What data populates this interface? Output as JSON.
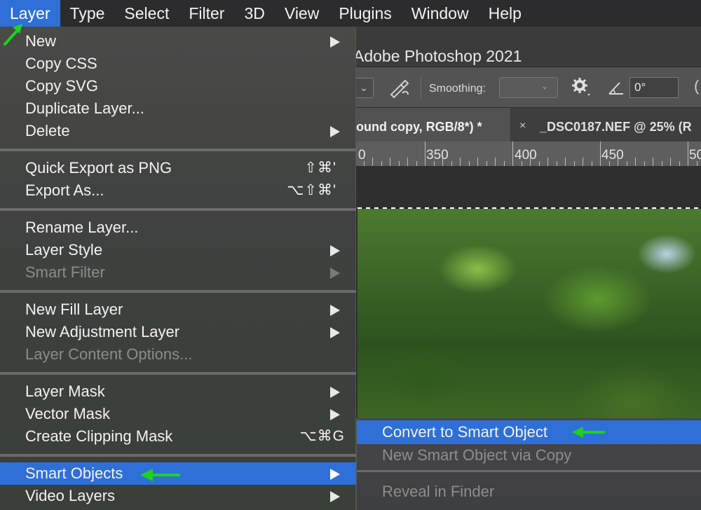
{
  "menubar": {
    "items": [
      {
        "label": "Layer",
        "active": true
      },
      {
        "label": "Type"
      },
      {
        "label": "Select"
      },
      {
        "label": "Filter"
      },
      {
        "label": "3D"
      },
      {
        "label": "View"
      },
      {
        "label": "Plugins"
      },
      {
        "label": "Window"
      },
      {
        "label": "Help"
      }
    ]
  },
  "app": {
    "title": "Adobe Photoshop 2021",
    "options": {
      "smoothing_label": "Smoothing:",
      "angle_value": "0°",
      "paren": "("
    },
    "tabs": [
      {
        "label": "ound copy, RGB/8*) *"
      },
      {
        "close": "×",
        "label": "_DSC0187.NEF @ 25% (R"
      }
    ],
    "ruler": [
      "0",
      "350",
      "400",
      "450",
      "50"
    ]
  },
  "layer_menu": {
    "items": [
      {
        "label": "New",
        "submenu": true
      },
      {
        "label": "Copy CSS"
      },
      {
        "label": "Copy SVG"
      },
      {
        "label": "Duplicate Layer..."
      },
      {
        "label": "Delete",
        "submenu": true
      },
      {
        "label": "Quick Export as PNG",
        "shortcut": "⇧⌘'"
      },
      {
        "label": "Export As...",
        "shortcut": "⌥⇧⌘'"
      },
      {
        "label": "Rename Layer..."
      },
      {
        "label": "Layer Style",
        "submenu": true
      },
      {
        "label": "Smart Filter",
        "submenu": true,
        "disabled": true
      },
      {
        "label": "New Fill Layer",
        "submenu": true
      },
      {
        "label": "New Adjustment Layer",
        "submenu": true
      },
      {
        "label": "Layer Content Options...",
        "disabled": true
      },
      {
        "label": "Layer Mask",
        "submenu": true
      },
      {
        "label": "Vector Mask",
        "submenu": true
      },
      {
        "label": "Create Clipping Mask",
        "shortcut": "⌥⌘G"
      },
      {
        "label": "Smart Objects",
        "submenu": true,
        "highlighted": true
      },
      {
        "label": "Video Layers",
        "submenu": true
      }
    ]
  },
  "smart_objects_submenu": {
    "items": [
      {
        "label": "Convert to Smart Object",
        "highlighted": true
      },
      {
        "label": "New Smart Object via Copy",
        "disabled": true
      },
      {
        "label": "Reveal in Finder",
        "disabled": true
      }
    ]
  },
  "colors": {
    "highlight": "#2f6fd8",
    "annotation_arrow": "#1fd21f"
  }
}
